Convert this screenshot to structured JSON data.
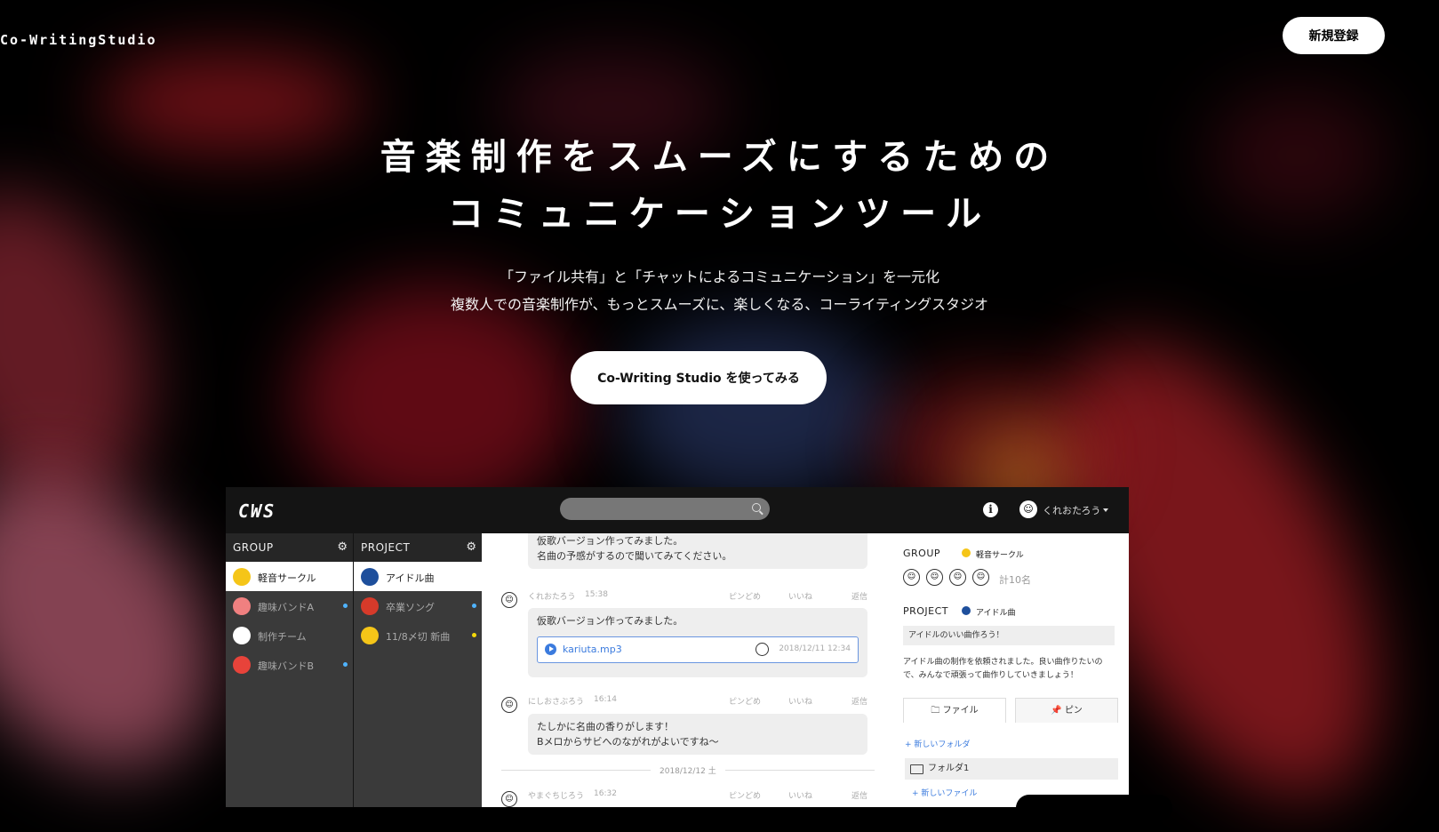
{
  "header": {
    "logo": "Co-WritingStudio",
    "signup_label": "新規登録"
  },
  "hero": {
    "title_line1": "音楽制作をスムーズにするための",
    "title_line2": "コミュニケーションツール",
    "sub_line1": "「ファイル共有」と「チャットによるコミュニケーション」を一元化",
    "sub_line2": "複数人での音楽制作が、もっとスムーズに、楽しくなる、コーライティングスタジオ",
    "cta_label": "Co-Writing Studio を使ってみる"
  },
  "app": {
    "logo": "CWS",
    "user_name": "くれおたろう",
    "group_col": {
      "header": "GROUP",
      "items": [
        {
          "label": "軽音サークル",
          "icon_color": "#f5c518",
          "dot": null
        },
        {
          "label": "趣味バンドA",
          "icon_color": "#f08080",
          "dot": "#4fb3ff"
        },
        {
          "label": "制作チーム",
          "icon_color": "#ffffff",
          "dot": null
        },
        {
          "label": "趣味バンドB",
          "icon_color": "#e8433a",
          "dot": "#4fb3ff"
        }
      ]
    },
    "project_col": {
      "header": "PROJECT",
      "items": [
        {
          "label": "アイドル曲",
          "icon_color": "#1e4f9c",
          "dot": null
        },
        {
          "label": "卒業ソング",
          "icon_color": "#d63a2a",
          "dot": "#4fb3ff"
        },
        {
          "label": "11/8〆切 新曲",
          "icon_color": "#f5c518",
          "dot": "#f5d90a"
        }
      ]
    },
    "chat": {
      "msg0_line1": "仮歌バージョン作ってみました。",
      "msg0_line2": "名曲の予感がするので聞いてみてください。",
      "msg1": {
        "author": "くれおたろう",
        "time": "15:38",
        "pin": "ピンどめ",
        "like": "いいね",
        "reply": "返信",
        "text": "仮歌バージョン作ってみました。",
        "file_name": "kariuta.mp3",
        "file_date": "2018/12/11 12:34"
      },
      "msg2": {
        "author": "にしおさぶろう",
        "time": "16:14",
        "pin": "ピンどめ",
        "like": "いいね",
        "reply": "返信",
        "line1": "たしかに名曲の香りがします！",
        "line2": "Bメロからサビへのながれがよいですね〜"
      },
      "date_sep": "2018/12/12 土",
      "msg3": {
        "author": "やまぐちじろう",
        "time": "16:32",
        "pin": "ピンどめ",
        "like": "いいね",
        "reply": "返信"
      }
    },
    "side": {
      "group_label": "GROUP",
      "group_name": "軽音サークル",
      "member_count": "計10名",
      "project_label": "PROJECT",
      "project_name": "アイドル曲",
      "project_title": "アイドルのいい曲作ろう！",
      "project_desc": "アイドル曲の制作を依頼されました。良い曲作りたいので、みんなで頑張って曲作りしていきましょう！",
      "tab_file": "ファイル",
      "tab_pin": "ピン",
      "new_folder": "+ 新しいフォルダ",
      "folder_name": "フォルダ1",
      "new_file": "+ 新しいファイル"
    }
  }
}
